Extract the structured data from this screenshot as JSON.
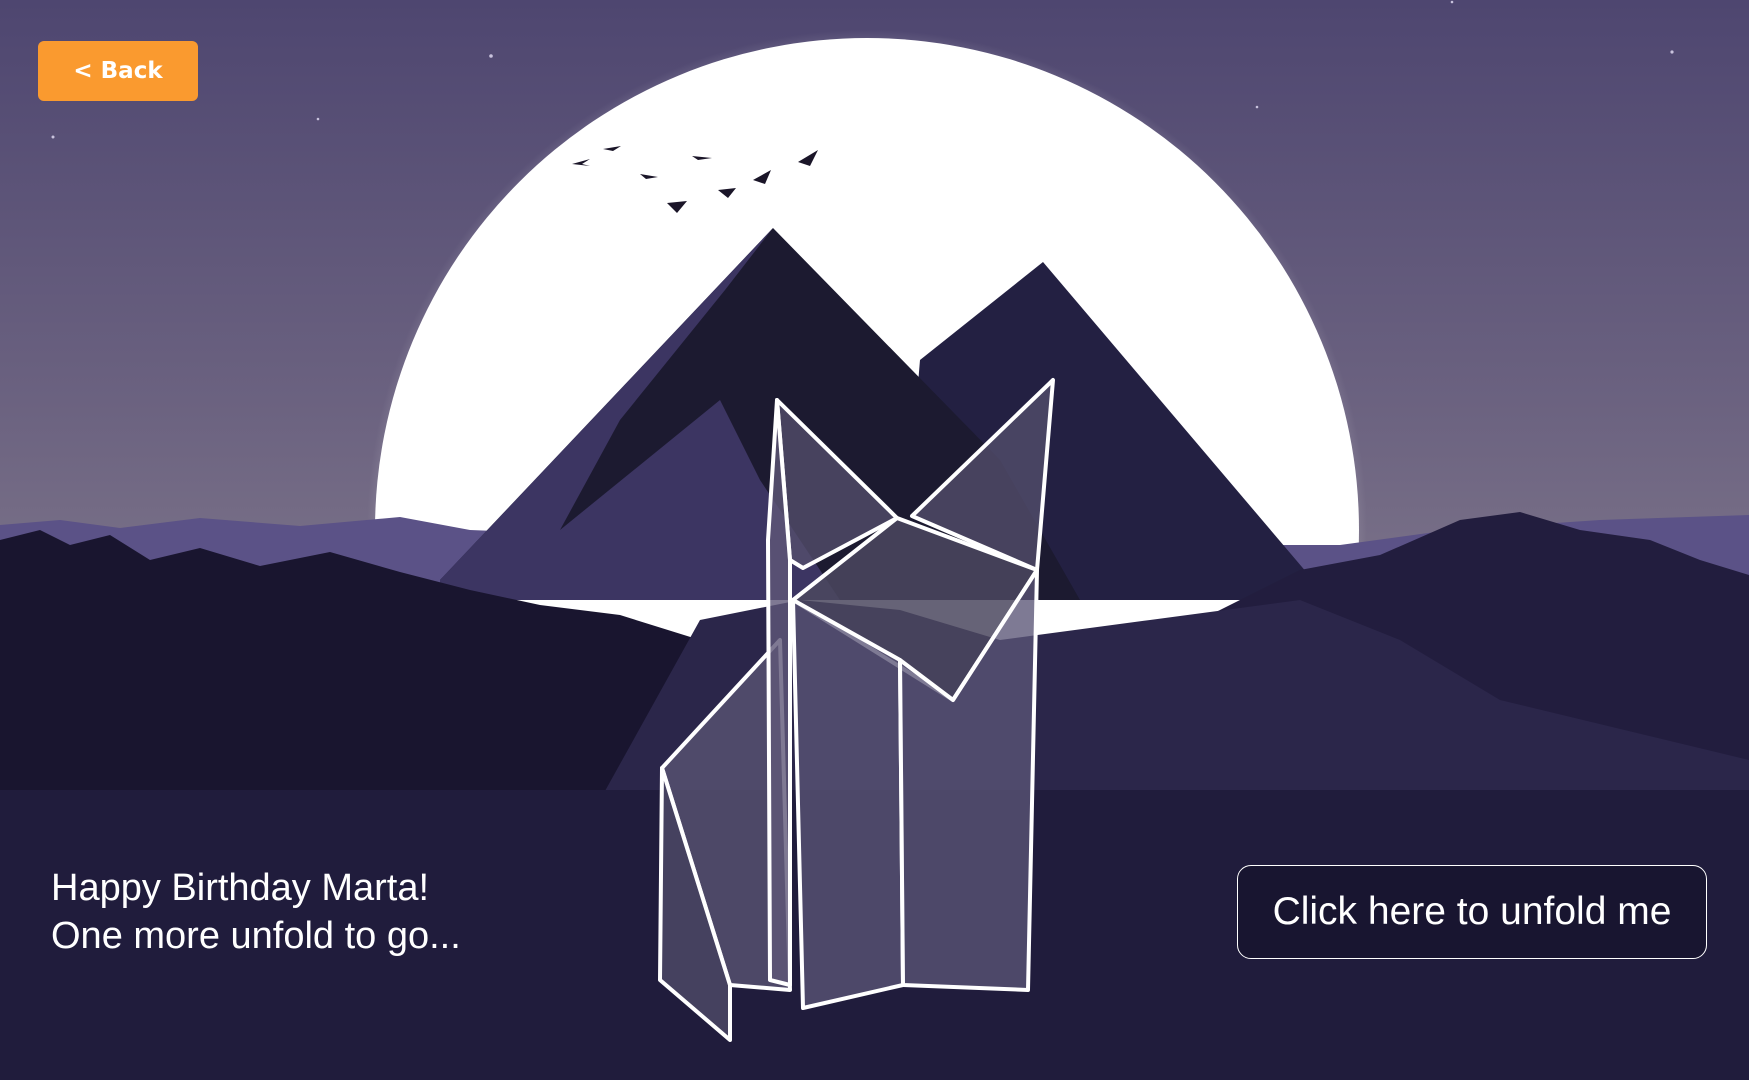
{
  "nav": {
    "back_label": "< Back"
  },
  "message": {
    "line1": "Happy Birthday Marta!",
    "line2": "One more unfold to go..."
  },
  "unfold_button": {
    "label": "Click here to unfold me"
  },
  "colors": {
    "accent": "#fa9a2f",
    "sky_top": "#4f466d",
    "ground": "#201c3c",
    "moon": "#ffffff"
  }
}
